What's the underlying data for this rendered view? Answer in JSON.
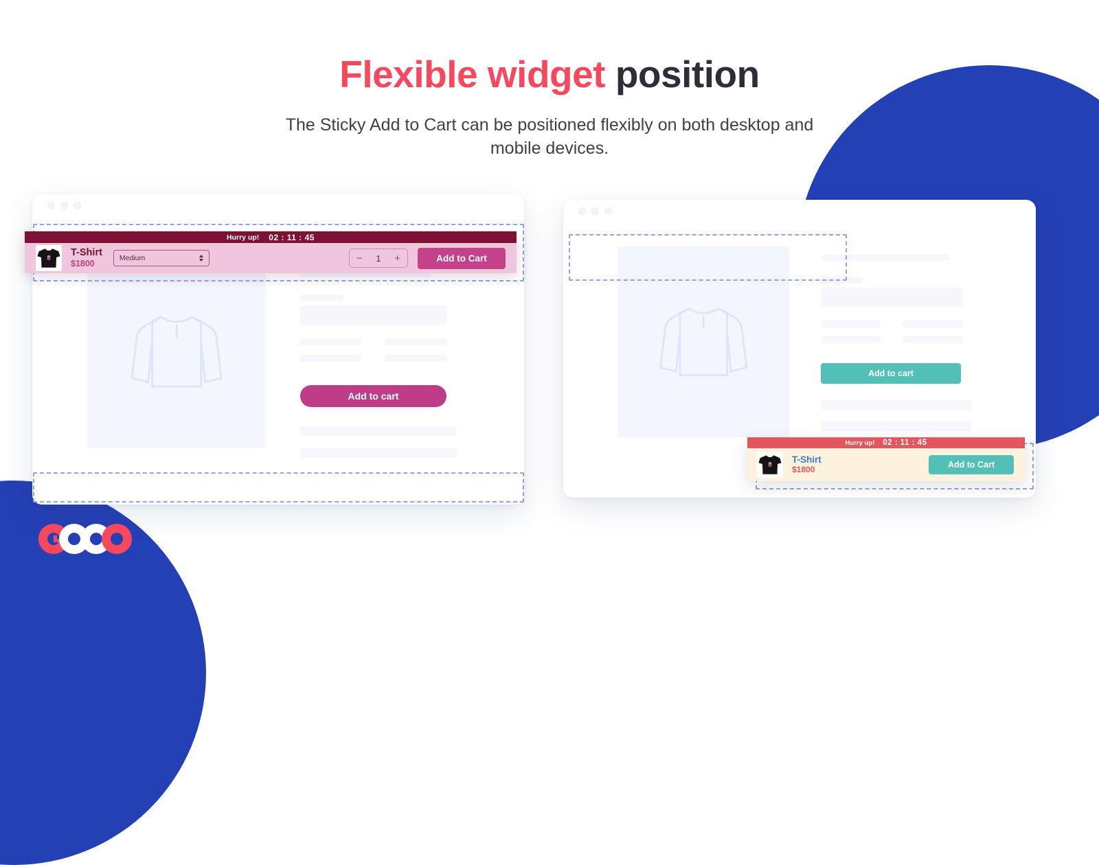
{
  "header": {
    "title_accent": "Flexible widget",
    "title_rest": " position",
    "subtitle": "The Sticky Add to Cart can be positioned flexibly on both desktop and mobile devices."
  },
  "colors": {
    "accent_red": "#f8485e",
    "brand_blue": "#2440b5",
    "pink_widget_bar": "#7d1234",
    "pink_widget_body": "#f0c6dd",
    "pink_button": "#c4428a",
    "cream_widget_body": "#fdf2dd",
    "red_widget_bar": "#e4565e",
    "teal_button": "#52c0b6",
    "skeleton": "#f5f7fd",
    "dashed_outline": "#8da4ec"
  },
  "logo": {
    "text": "GOOO",
    "letters": [
      "G",
      "O",
      "O",
      "O"
    ],
    "letter_colors": [
      "#f8485e",
      "#ffffff",
      "#ffffff",
      "#f8485e"
    ]
  },
  "windows": {
    "left": {
      "name": "Desktop product page — widget at top",
      "dots": [
        "window-close-dot",
        "window-minimize-dot",
        "window-maximize-dot"
      ],
      "add_to_cart_label": "Add to cart",
      "add_to_cart_color": "#bf3d88",
      "placeholder_image_icon": "long-sleeve-shirt-icon"
    },
    "right": {
      "name": "Desktop product page — widget at bottom",
      "dots": [
        "window-close-dot",
        "window-minimize-dot",
        "window-maximize-dot"
      ],
      "add_to_cart_label": "Add to cart",
      "add_to_cart_color": "#52c0b6",
      "placeholder_image_icon": "long-sleeve-shirt-icon"
    }
  },
  "sticky_widget_left": {
    "hurry_label": "Hurry up!",
    "countdown": "02 : 11 : 45",
    "product_name": "T-Shirt",
    "product_price": "$1800",
    "variant_value": "Medium",
    "quantity": "1",
    "minus_label": "−",
    "plus_label": "+",
    "add_to_cart_label": "Add to Cart",
    "thumbnail_icon": "tshirt-thumbnail-icon"
  },
  "sticky_widget_right": {
    "hurry_label": "Hurry up!",
    "countdown": "02 : 11 : 45",
    "product_name": "T-Shirt",
    "product_price": "$1800",
    "add_to_cart_label": "Add to Cart",
    "thumbnail_icon": "tshirt-thumbnail-icon"
  }
}
